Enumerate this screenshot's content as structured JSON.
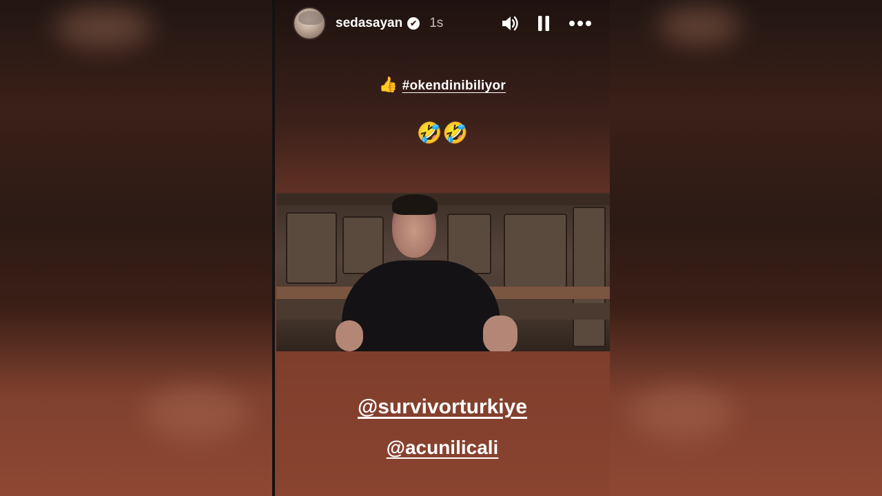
{
  "header": {
    "username": "sedasayan",
    "verified_badge": "✔",
    "timestamp": "1s"
  },
  "icons": {
    "volume": "speaker-icon",
    "pause": "pause-icon",
    "more": "more-icon",
    "verified": "verified-badge-icon"
  },
  "caption": {
    "thumb_emoji": "👍",
    "hashtag": "#okendinibiliyor",
    "laugh_emojis": "🤣🤣"
  },
  "mentions": [
    "@survivorturkiye",
    "@acunilicali"
  ],
  "colors": {
    "text": "#ffffff",
    "panel_top": "#1e1210",
    "panel_bottom": "#8a4430"
  }
}
